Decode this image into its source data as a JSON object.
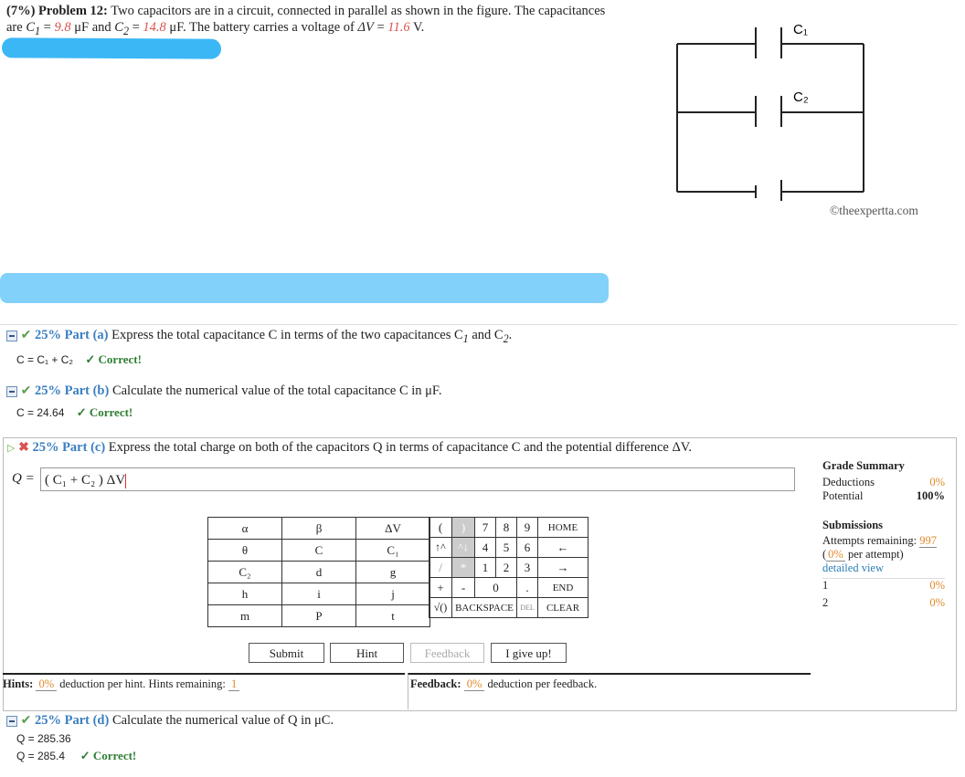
{
  "problem": {
    "header": "(7%) Problem 12:",
    "text1": "Two capacitors are in a circuit, connected in parallel as shown in the figure. The capacitances are",
    "c1_sym": "C",
    "c1_sub": "1",
    "c1_val": "9.8",
    "unit_uF": "μF",
    "and": "and",
    "c2_sym": "C",
    "c2_sub": "2",
    "c2_val": "14.8",
    "text2": ". The battery carries a voltage of",
    "dv": "ΔV",
    "dv_val": "11.6",
    "unit_V": "V."
  },
  "figure": {
    "label_c1": "C₁",
    "label_c2": "C₂",
    "copyright": "©theexpertta.com"
  },
  "parts": {
    "a": {
      "pct": "25% Part (a)",
      "text": "Express the total capacitance C in terms of the two capacitances C",
      "text_sub1": "1",
      "text_and": "and C",
      "text_sub2": "2",
      "answer": "C = C₁ + C₂",
      "status": "✓ Correct!"
    },
    "b": {
      "pct": "25% Part (b)",
      "text": "Calculate the numerical value of the total capacitance C in μF.",
      "answer": "C = 24.64",
      "status": "✓ Correct!"
    },
    "c": {
      "pct": "25% Part (c)",
      "text": "Express the total charge on both of the capacitors Q in terms of capacitance C and the potential difference ΔV.",
      "q_label": "Q =",
      "input_value": "( C₁ + C₂ ) ΔV"
    },
    "d": {
      "pct": "25% Part (d)",
      "text": "Calculate the numerical value of Q in μC.",
      "answer1": "Q = 285.36",
      "answer2": "Q = 285.4",
      "status": "✓ Correct!"
    }
  },
  "keypad": {
    "symbols": [
      [
        "α",
        "β",
        "ΔV"
      ],
      [
        "θ",
        "C",
        "C₁"
      ],
      [
        "C₂",
        "d",
        "g"
      ],
      [
        "h",
        "i",
        "j"
      ],
      [
        "m",
        "P",
        "t"
      ]
    ],
    "ops": [
      [
        "(",
        ")"
      ],
      [
        "↑^",
        "^↓"
      ],
      [
        "/",
        "*"
      ],
      [
        "+",
        "-"
      ]
    ],
    "sqrt": "√()",
    "backspace": "BACKSPACE",
    "del": "DEL",
    "clear": "CLEAR",
    "digits": [
      [
        "7",
        "8",
        "9"
      ],
      [
        "4",
        "5",
        "6"
      ],
      [
        "1",
        "2",
        "3"
      ]
    ],
    "zero": "0",
    "dot": ".",
    "home": "HOME",
    "left": "←",
    "right": "→",
    "end": "END"
  },
  "buttons": {
    "submit": "Submit",
    "hint": "Hint",
    "feedback": "Feedback",
    "giveup": "I give up!"
  },
  "hints": {
    "label": "Hints:",
    "pct": "0%",
    "text": "deduction per hint. Hints remaining:",
    "remaining": "1"
  },
  "feedback": {
    "label": "Feedback:",
    "pct": "0%",
    "text": "deduction per feedback."
  },
  "grade": {
    "title": "Grade Summary",
    "deductions_label": "Deductions",
    "deductions_val": "0%",
    "potential_label": "Potential",
    "potential_val": "100%",
    "submissions_title": "Submissions",
    "attempts_label": "Attempts remaining:",
    "attempts_val": "997",
    "per_attempt_pct": "0%",
    "per_attempt_text": "per attempt)",
    "detailed": "detailed view",
    "rows": [
      {
        "n": "1",
        "v": "0%"
      },
      {
        "n": "2",
        "v": "0%"
      }
    ]
  },
  "colors": {
    "accent_blue": "#3a7fc1",
    "value_red": "#d9534f",
    "correct_green": "#2e7d32",
    "link_orange": "#e08a2c",
    "scribble": "#3bb7f6"
  }
}
